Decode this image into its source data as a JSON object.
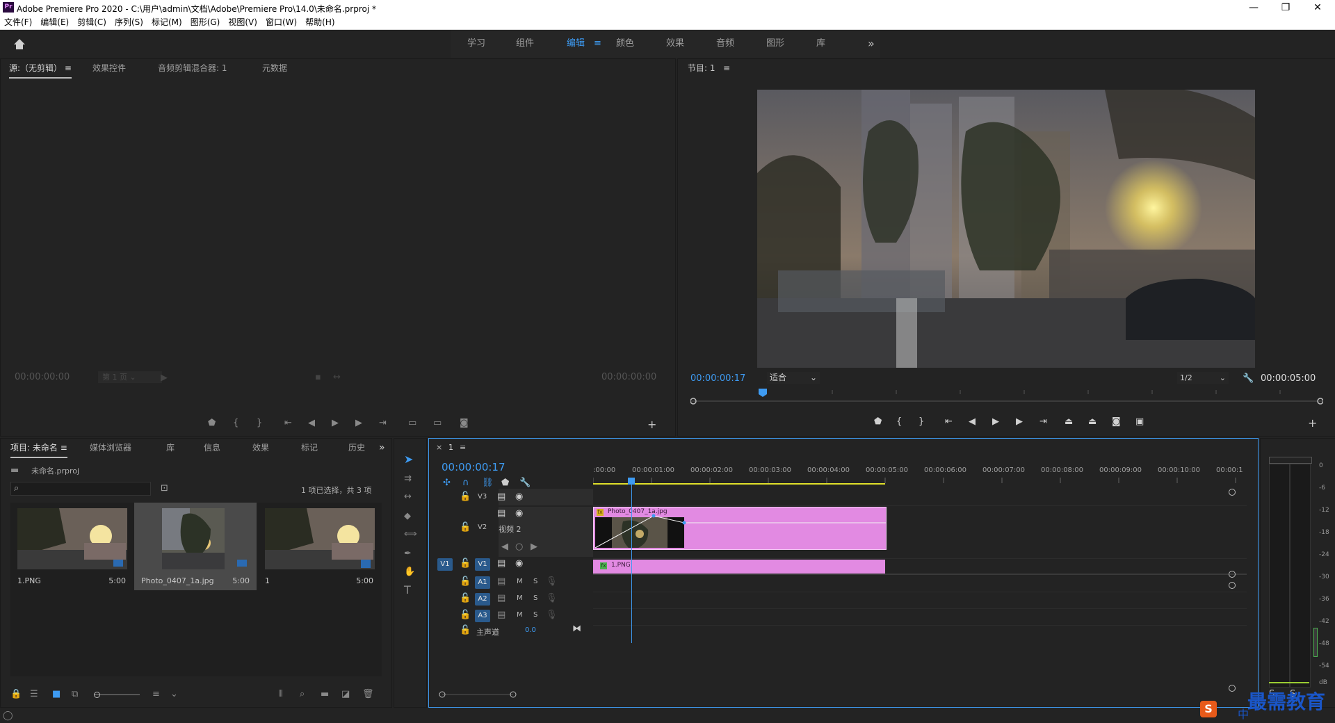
{
  "window": {
    "app_icon": "Pr",
    "title": "Adobe Premiere Pro 2020 - C:\\用户\\admin\\文档\\Adobe\\Premiere Pro\\14.0\\未命名.prproj *",
    "controls": [
      "minimize-icon",
      "restore-icon",
      "close-icon"
    ]
  },
  "menu": [
    "文件(F)",
    "编辑(E)",
    "剪辑(C)",
    "序列(S)",
    "标记(M)",
    "图形(G)",
    "视图(V)",
    "窗口(W)",
    "帮助(H)"
  ],
  "workspaces": {
    "tabs": [
      "学习",
      "组件",
      "编辑",
      "颜色",
      "效果",
      "音频",
      "图形",
      "库"
    ],
    "active": "编辑",
    "menu_glyph": "≡",
    "overflow": "»"
  },
  "source_panel": {
    "tabs": [
      "源:（无剪辑）",
      "效果控件",
      "音频剪辑混合器: 1",
      "元数据"
    ],
    "menu_glyph": "≡",
    "timecode_left": "00:00:00:00",
    "page_select": "第 1 页",
    "timecode_right": "00:00:00:00"
  },
  "program_panel": {
    "title": "节目: 1",
    "menu_glyph": "≡",
    "timecode": "00:00:00:17",
    "fit": "适合",
    "resolution": "1/2",
    "duration": "00:00:05:00"
  },
  "project_panel": {
    "tabs": [
      "项目: 未命名",
      "媒体浏览器",
      "库",
      "信息",
      "效果",
      "标记",
      "历史"
    ],
    "menu_glyph": "≡",
    "overflow": "»",
    "file": "未命名.prproj",
    "search_placeholder": "",
    "selection_info": "1 项已选择，共 3 项",
    "items": [
      {
        "name": "1.PNG",
        "duration": "5:00",
        "selected": false
      },
      {
        "name": "Photo_0407_1a.jpg",
        "duration": "5:00",
        "selected": true
      },
      {
        "name": "1",
        "duration": "5:00",
        "selected": false
      }
    ]
  },
  "tools": [
    "selection-tool",
    "track-select-tool",
    "ripple-edit-tool",
    "razor-tool",
    "slip-tool",
    "pen-tool",
    "hand-tool",
    "type-tool"
  ],
  "timeline": {
    "tab": "1",
    "close_glyph": "×",
    "menu_glyph": "≡",
    "timecode": "00:00:00:17",
    "ruler": [
      ":00:00",
      "00:00:01:00",
      "00:00:02:00",
      "00:00:03:00",
      "00:00:04:00",
      "00:00:05:00",
      "00:00:06:00",
      "00:00:07:00",
      "00:00:08:00",
      "00:00:09:00",
      "00:00:10:00",
      "00:00:1"
    ],
    "tracks": {
      "v3": "V3",
      "v2": "V2",
      "v2_name": "视频 2",
      "v1": "V1",
      "v1_source": "V1",
      "a1": "A1",
      "a2": "A2",
      "a3": "A3",
      "mute": "M",
      "solo": "S",
      "master": "主声道",
      "master_value": "0.0"
    },
    "clips": {
      "v2_clip": "Photo_0407_1a.jpg",
      "v2_fx": "fx",
      "v1_clip": "1.PNG",
      "v1_fx": "fx"
    },
    "clip_color": "#e28ae2"
  },
  "audio_meter": {
    "scale": [
      "0",
      "-6",
      "-12",
      "-18",
      "-24",
      "-30",
      "-36",
      "-42",
      "-48",
      "-54",
      "dB"
    ]
  },
  "watermark": {
    "text": "最需教育",
    "ime": "中"
  },
  "colors": {
    "accent": "#3e9bf2",
    "clip": "#e28ae2",
    "panel_bg": "#232323",
    "playhead": "#3e9bf2"
  }
}
